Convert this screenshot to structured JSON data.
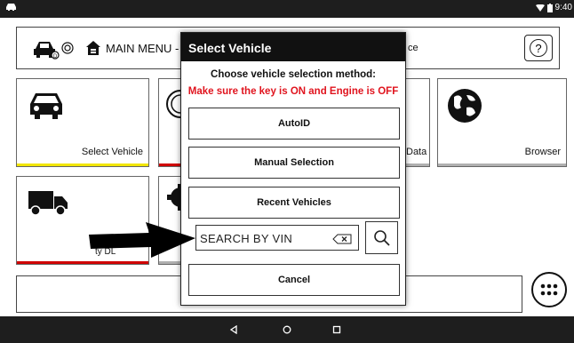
{
  "status_bar": {
    "time": "9:40"
  },
  "header": {
    "menu_title": "MAIN MENU - ",
    "menu_tail": "ce",
    "help_label": "?"
  },
  "tiles": [
    {
      "label": "Select Vehicle",
      "bar_color": "#f2e600"
    },
    {
      "label": "Data",
      "bar_color": "#d00000"
    },
    {
      "label": "Browser",
      "bar_color": "#b0b0b0"
    },
    {
      "label": "ty DL",
      "bar_color": "#d00000"
    }
  ],
  "dialog": {
    "title": "Select Vehicle",
    "subtitle": "Choose vehicle selection method:",
    "warning": "Make sure the key is ON and Engine is OFF",
    "warning_color": "#e0141e",
    "buttons": {
      "autoid": "AutoID",
      "manual": "Manual Selection",
      "recent": "Recent Vehicles",
      "cancel": "Cancel"
    },
    "search": {
      "placeholder": "SEARCH BY VIN"
    }
  },
  "icons": {
    "vehicle-status": "car-icon",
    "clear": "backspace-clear-icon",
    "search": "magnifier-icon",
    "apps": "apps-grid-icon",
    "nav_back": "back-triangle-icon",
    "nav_home": "home-circle-icon",
    "nav_recent": "recent-square-icon"
  }
}
